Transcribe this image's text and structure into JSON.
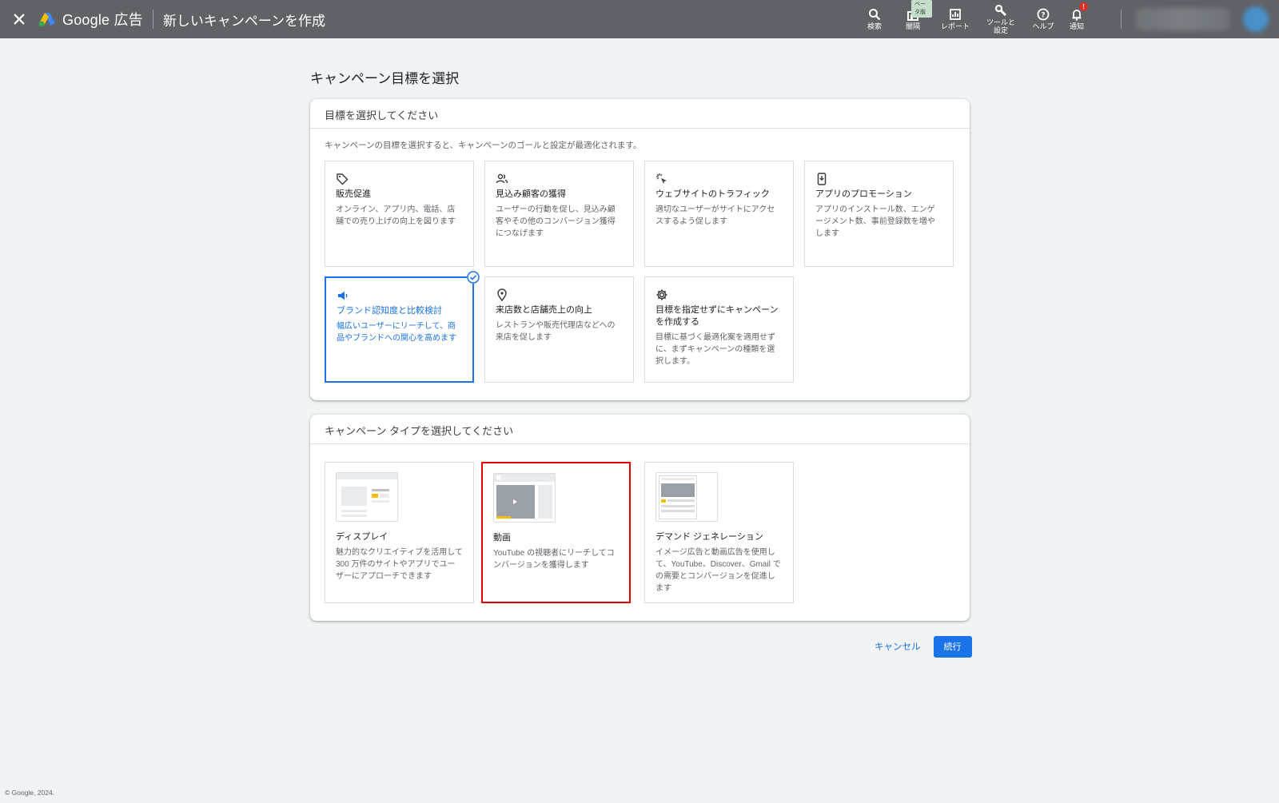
{
  "header": {
    "product_name": "Google 広告",
    "page_heading": "新しいキャンペーンを作成",
    "nav": [
      {
        "label": "検索",
        "icon": "search-icon"
      },
      {
        "label": "闇隔",
        "icon": "appearance-icon",
        "badge": "ベータ版"
      },
      {
        "label": "レポート",
        "icon": "reports-icon"
      },
      {
        "label": "ツールと\n設定",
        "icon": "tools-icon"
      },
      {
        "label": "ヘルプ",
        "icon": "help-icon"
      },
      {
        "label": "通知",
        "icon": "bell-icon",
        "badge": "!"
      }
    ]
  },
  "main_title": "キャンペーン目標を選択",
  "goals_panel": {
    "heading": "目標を選択してください",
    "description": "キャンペーンの目標を選択すると、キャンペーンのゴールと設定が最適化されます。",
    "cards": [
      {
        "icon": "tag-icon",
        "title": "販売促進",
        "desc": "オンライン、アプリ内、電話、店舗での売り上げの向上を図ります"
      },
      {
        "icon": "people-icon",
        "title": "見込み顧客の獲得",
        "desc": "ユーザーの行動を促し、見込み顧客やその他のコンバージョン獲得につなげます"
      },
      {
        "icon": "click-icon",
        "title": "ウェブサイトのトラフィック",
        "desc": "適切なユーザーがサイトにアクセスするよう促します"
      },
      {
        "icon": "phone-download-icon",
        "title": "アプリのプロモーション",
        "desc": "アプリのインストール数、エンゲージメント数、事前登録数を増やします"
      },
      {
        "icon": "megaphone-icon",
        "title": "ブランド認知度と比較検討",
        "desc": "幅広いユーザーにリーチして、商品やブランドへの関心を高めます",
        "selected": true
      },
      {
        "icon": "location-pin-icon",
        "title": "来店数と店舗売上の向上",
        "desc": "レストランや販売代理店などへの来店を促します"
      },
      {
        "icon": "gear-icon",
        "title": "目標を指定せずにキャンペーンを作成する",
        "desc": "目標に基づく最適化案を適用せずに、まずキャンペーンの種類を選択します。"
      }
    ]
  },
  "types_panel": {
    "heading": "キャンペーン タイプを選択してください",
    "cards": [
      {
        "title": "ディスプレイ",
        "desc": "魅力的なクリエイティブを活用して 300 万件のサイトやアプリでユーザーにアプローチできます"
      },
      {
        "title": "動画",
        "desc": "YouTube の視聴者にリーチしてコンバージョンを獲得します"
      },
      {
        "title": "デマンド ジェネレーション",
        "desc": "イメージ広告と動画広告を使用して、YouTube、Discover、Gmail での需要とコンバージョンを促進します"
      }
    ]
  },
  "actions": {
    "cancel_label": "キャンセル",
    "continue_label": "続行"
  },
  "copyright": "© Google, 2024.",
  "colors": {
    "topbar": "#5f6368",
    "accent": "#1a73e8",
    "highlight": "#e00000"
  }
}
